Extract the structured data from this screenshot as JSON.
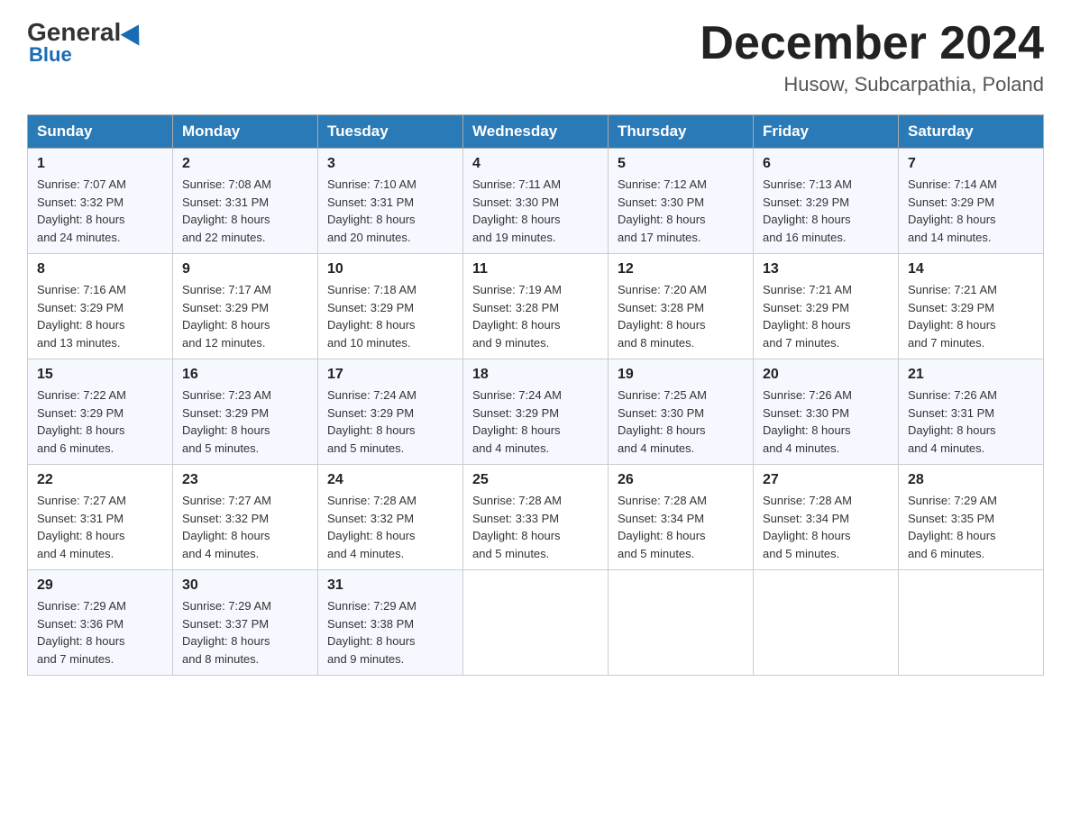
{
  "header": {
    "logo_general": "General",
    "logo_blue": "Blue",
    "month_title": "December 2024",
    "location": "Husow, Subcarpathia, Poland"
  },
  "days_of_week": [
    "Sunday",
    "Monday",
    "Tuesday",
    "Wednesday",
    "Thursday",
    "Friday",
    "Saturday"
  ],
  "weeks": [
    [
      {
        "day": "1",
        "info": "Sunrise: 7:07 AM\nSunset: 3:32 PM\nDaylight: 8 hours\nand 24 minutes."
      },
      {
        "day": "2",
        "info": "Sunrise: 7:08 AM\nSunset: 3:31 PM\nDaylight: 8 hours\nand 22 minutes."
      },
      {
        "day": "3",
        "info": "Sunrise: 7:10 AM\nSunset: 3:31 PM\nDaylight: 8 hours\nand 20 minutes."
      },
      {
        "day": "4",
        "info": "Sunrise: 7:11 AM\nSunset: 3:30 PM\nDaylight: 8 hours\nand 19 minutes."
      },
      {
        "day": "5",
        "info": "Sunrise: 7:12 AM\nSunset: 3:30 PM\nDaylight: 8 hours\nand 17 minutes."
      },
      {
        "day": "6",
        "info": "Sunrise: 7:13 AM\nSunset: 3:29 PM\nDaylight: 8 hours\nand 16 minutes."
      },
      {
        "day": "7",
        "info": "Sunrise: 7:14 AM\nSunset: 3:29 PM\nDaylight: 8 hours\nand 14 minutes."
      }
    ],
    [
      {
        "day": "8",
        "info": "Sunrise: 7:16 AM\nSunset: 3:29 PM\nDaylight: 8 hours\nand 13 minutes."
      },
      {
        "day": "9",
        "info": "Sunrise: 7:17 AM\nSunset: 3:29 PM\nDaylight: 8 hours\nand 12 minutes."
      },
      {
        "day": "10",
        "info": "Sunrise: 7:18 AM\nSunset: 3:29 PM\nDaylight: 8 hours\nand 10 minutes."
      },
      {
        "day": "11",
        "info": "Sunrise: 7:19 AM\nSunset: 3:28 PM\nDaylight: 8 hours\nand 9 minutes."
      },
      {
        "day": "12",
        "info": "Sunrise: 7:20 AM\nSunset: 3:28 PM\nDaylight: 8 hours\nand 8 minutes."
      },
      {
        "day": "13",
        "info": "Sunrise: 7:21 AM\nSunset: 3:29 PM\nDaylight: 8 hours\nand 7 minutes."
      },
      {
        "day": "14",
        "info": "Sunrise: 7:21 AM\nSunset: 3:29 PM\nDaylight: 8 hours\nand 7 minutes."
      }
    ],
    [
      {
        "day": "15",
        "info": "Sunrise: 7:22 AM\nSunset: 3:29 PM\nDaylight: 8 hours\nand 6 minutes."
      },
      {
        "day": "16",
        "info": "Sunrise: 7:23 AM\nSunset: 3:29 PM\nDaylight: 8 hours\nand 5 minutes."
      },
      {
        "day": "17",
        "info": "Sunrise: 7:24 AM\nSunset: 3:29 PM\nDaylight: 8 hours\nand 5 minutes."
      },
      {
        "day": "18",
        "info": "Sunrise: 7:24 AM\nSunset: 3:29 PM\nDaylight: 8 hours\nand 4 minutes."
      },
      {
        "day": "19",
        "info": "Sunrise: 7:25 AM\nSunset: 3:30 PM\nDaylight: 8 hours\nand 4 minutes."
      },
      {
        "day": "20",
        "info": "Sunrise: 7:26 AM\nSunset: 3:30 PM\nDaylight: 8 hours\nand 4 minutes."
      },
      {
        "day": "21",
        "info": "Sunrise: 7:26 AM\nSunset: 3:31 PM\nDaylight: 8 hours\nand 4 minutes."
      }
    ],
    [
      {
        "day": "22",
        "info": "Sunrise: 7:27 AM\nSunset: 3:31 PM\nDaylight: 8 hours\nand 4 minutes."
      },
      {
        "day": "23",
        "info": "Sunrise: 7:27 AM\nSunset: 3:32 PM\nDaylight: 8 hours\nand 4 minutes."
      },
      {
        "day": "24",
        "info": "Sunrise: 7:28 AM\nSunset: 3:32 PM\nDaylight: 8 hours\nand 4 minutes."
      },
      {
        "day": "25",
        "info": "Sunrise: 7:28 AM\nSunset: 3:33 PM\nDaylight: 8 hours\nand 5 minutes."
      },
      {
        "day": "26",
        "info": "Sunrise: 7:28 AM\nSunset: 3:34 PM\nDaylight: 8 hours\nand 5 minutes."
      },
      {
        "day": "27",
        "info": "Sunrise: 7:28 AM\nSunset: 3:34 PM\nDaylight: 8 hours\nand 5 minutes."
      },
      {
        "day": "28",
        "info": "Sunrise: 7:29 AM\nSunset: 3:35 PM\nDaylight: 8 hours\nand 6 minutes."
      }
    ],
    [
      {
        "day": "29",
        "info": "Sunrise: 7:29 AM\nSunset: 3:36 PM\nDaylight: 8 hours\nand 7 minutes."
      },
      {
        "day": "30",
        "info": "Sunrise: 7:29 AM\nSunset: 3:37 PM\nDaylight: 8 hours\nand 8 minutes."
      },
      {
        "day": "31",
        "info": "Sunrise: 7:29 AM\nSunset: 3:38 PM\nDaylight: 8 hours\nand 9 minutes."
      },
      {
        "day": "",
        "info": ""
      },
      {
        "day": "",
        "info": ""
      },
      {
        "day": "",
        "info": ""
      },
      {
        "day": "",
        "info": ""
      }
    ]
  ]
}
